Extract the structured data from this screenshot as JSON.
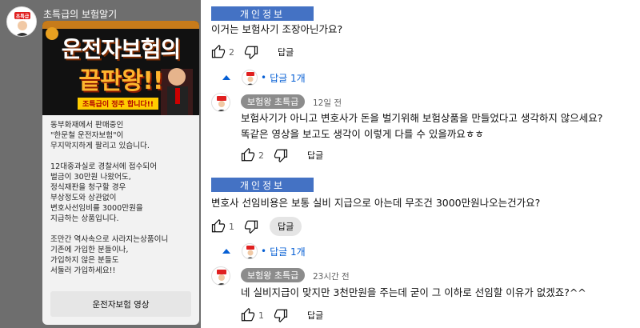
{
  "channel": {
    "name": "초특급의 보험알기",
    "avatar_text": "초특급"
  },
  "post": {
    "banner": {
      "line1": "운전자보험의",
      "line2": "끝판왕!!",
      "strip": "조특급이 정주 합니다!!"
    },
    "paragraphs": [
      [
        "동부화재에서 판매중인",
        "\"한문철 운전자보험\"이",
        "무지막지하게 팔리고 있습니다."
      ],
      [
        "12대중과실로 경찰서에 접수되어",
        "벌금이 30만원 나왔어도,",
        "정식재판을 청구할 경우",
        "부상정도와 상관없이",
        "변호사선임비를 3000만원을",
        "지급하는 상품입니다."
      ],
      [
        "조만간 역사속으로 사라지는상품이니",
        "기존에 가입한 분들이나,",
        "가입하지 않은 분들도",
        "서둘러 가입하세요!!"
      ]
    ],
    "link_label": "운전자보험 영상"
  },
  "comments": [
    {
      "mask_label": "개인정보",
      "text": "이거는 보험사기 조장아닌가요?",
      "like_count": "2",
      "reply_label": "답글",
      "replies_toggle": "답글 1개",
      "reply": {
        "author": "보험왕 초특급",
        "time": "12일 전",
        "lines": [
          "보험사기가 아니고 변호사가 돈을 벌기위해 보험상품을 만들었다고 생각하지 않으세요?",
          "똑같은 영상을 보고도 생각이 이렇게 다를 수 있을까요ㅎㅎ"
        ],
        "like_count": "2",
        "reply_label": "답글"
      }
    },
    {
      "mask_label": "개인정보",
      "text": "변호사 선임비용은 보통 실비 지급으로 아는데 무조건 3000만원나오는건가요?",
      "like_count": "1",
      "reply_label": "답글",
      "replies_toggle": "답글 1개",
      "reply": {
        "author": "보험왕 초특급",
        "time": "23시간 전",
        "lines": [
          "네 실비지급이 맞지만 3천만원을 주는데 굳이 그 이하로 선임할 이유가 없겠죠?^^"
        ],
        "like_count": "1",
        "reply_label": "답글"
      }
    }
  ],
  "colors": {
    "mask": "#4472c4",
    "left_panel": "#6e6e6e",
    "link_blue": "#065fd4",
    "badge": "#8c8c8c"
  }
}
